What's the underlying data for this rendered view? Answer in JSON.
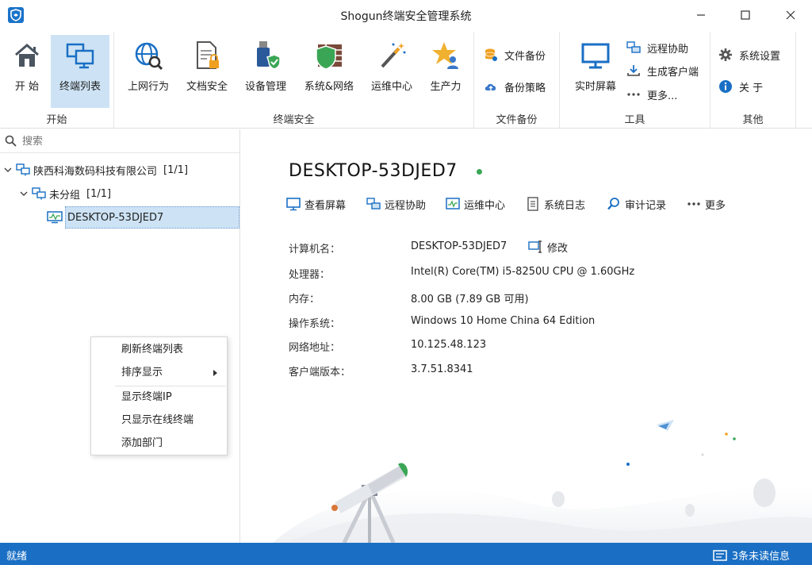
{
  "window": {
    "title": "Shogun终端安全管理系统"
  },
  "ribbon": {
    "start": {
      "label": "开始",
      "home": "开 始",
      "terminal_list": "终端列表"
    },
    "security": {
      "label": "终端安全",
      "internet": "上网行为",
      "docs": "文档安全",
      "devices": "设备管理",
      "sysnet": "系统&网络",
      "ops": "运维中心",
      "productivity": "生产力"
    },
    "backup": {
      "label": "文件备份",
      "file_backup": "文件备份",
      "policy": "备份策略"
    },
    "tools": {
      "label": "工具",
      "realtime": "实时屏幕",
      "remote": "远程协助",
      "gen_client": "生成客户端",
      "more": "更多..."
    },
    "other": {
      "label": "其他",
      "settings": "系统设置",
      "about": "关 于"
    }
  },
  "sidebar": {
    "search_placeholder": "搜索",
    "tree": {
      "company": "陕西科海数码科技有限公司",
      "company_count": "[1/1]",
      "group": "未分组",
      "group_count": "[1/1]",
      "device": "DESKTOP-53DJED7"
    }
  },
  "context_menu": {
    "items": [
      "刷新终端列表",
      "排序显示",
      "显示终端IP",
      "只显示在线终端",
      "添加部门"
    ]
  },
  "detail": {
    "name": "DESKTOP-53DJED7",
    "actions": [
      "查看屏幕",
      "远程协助",
      "运维中心",
      "系统日志",
      "审计记录",
      "更多"
    ],
    "edit": "修改",
    "fields": [
      {
        "label": "计算机名：",
        "value": "DESKTOP-53DJED7"
      },
      {
        "label": "处理器：",
        "value": "Intel(R) Core(TM) i5-8250U CPU @ 1.60GHz"
      },
      {
        "label": "内存：",
        "value": "8.00 GB (7.89 GB 可用)"
      },
      {
        "label": "操作系统：",
        "value": "Windows 10 Home China 64 Edition"
      },
      {
        "label": "网络地址：",
        "value": "10.125.48.123"
      },
      {
        "label": "客户端版本：",
        "value": "3.7.51.8341"
      }
    ]
  },
  "status": {
    "text": "就绪",
    "messages": "3条未读信息"
  },
  "colors": {
    "accent": "#1a6fc4",
    "selection": "#cde3f5",
    "online": "#3aa655"
  }
}
